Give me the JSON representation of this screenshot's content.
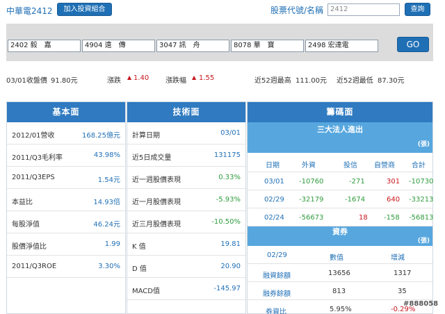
{
  "header": {
    "stock_title": "中華電2412",
    "add_portfolio": "加入投資組合",
    "search_label": "股票代號/名稱",
    "search_value": "2412",
    "query": "查詢"
  },
  "compare": {
    "inputs": [
      "2402 毅　嘉",
      "4904 遠　傳",
      "3047 訊　舟",
      "8078 華　寶",
      "2498 宏達電"
    ],
    "go": "GO"
  },
  "price_info": {
    "close_label": "03/01收盤價",
    "close_value": "91.80元",
    "change_label": "漲跌",
    "change_value": "1.40",
    "change_pct_label": "漲跌幅",
    "change_pct_value": "1.55",
    "high52_label": "近52週最高",
    "high52_value": "111.00元",
    "low52_label": "近52週最低",
    "low52_value": "87.30元"
  },
  "fundamentals": {
    "title": "基本面",
    "rows": [
      {
        "k": "2012/01營收",
        "v": "168.25億元"
      },
      {
        "k": "2011/Q3毛利率",
        "v": "43.98%"
      },
      {
        "k": "2011/Q3EPS",
        "v": "1.54元"
      },
      {
        "k": "本益比",
        "v": "14.93倍"
      },
      {
        "k": "每股淨值",
        "v": "46.24元"
      },
      {
        "k": "股價淨值比",
        "v": "1.99"
      },
      {
        "k": "2011/Q3ROE",
        "v": "3.30%"
      }
    ]
  },
  "technicals": {
    "title": "技術面",
    "rows": [
      {
        "k": "計算日期",
        "v": "03/01"
      },
      {
        "k": "近5日成交量",
        "v": "131175"
      },
      {
        "k": "近一週股價表現",
        "v": "0.33%"
      },
      {
        "k": "近一月股價表現",
        "v": "-5.93%"
      },
      {
        "k": "近三月股價表現",
        "v": "-10.50%"
      },
      {
        "k": "K 值",
        "v": "19.81"
      },
      {
        "k": "D 值",
        "v": "20.90"
      },
      {
        "k": "MACD值",
        "v": "-145.97"
      }
    ]
  },
  "chips": {
    "title": "籌碼面",
    "institutional": {
      "title": "三大法人進出",
      "unit": "(張)",
      "headers": [
        "日期",
        "外資",
        "投信",
        "自營商",
        "合計"
      ],
      "rows": [
        [
          "03/01",
          "-10760",
          "-271",
          "301",
          "-10730"
        ],
        [
          "02/29",
          "-32179",
          "-1674",
          "640",
          "-33213"
        ],
        [
          "02/24",
          "-56673",
          "18",
          "-158",
          "-56813"
        ]
      ]
    },
    "margin": {
      "title": "資券",
      "unit": "(張)",
      "headers": [
        "02/29",
        "數值",
        "增減"
      ],
      "rows": [
        [
          "融資餘額",
          "13656",
          "1317"
        ],
        [
          "融券餘額",
          "813",
          "35"
        ],
        [
          "券資比",
          "5.95%",
          "-0.29%"
        ]
      ]
    }
  },
  "watermark": "#888058",
  "colors": {
    "accent": "#1f6fb5",
    "header_bg": "#2f7ac0",
    "sub_header_bg": "#57a7de",
    "up": "#c8161d",
    "down": "#2e9b3c"
  }
}
